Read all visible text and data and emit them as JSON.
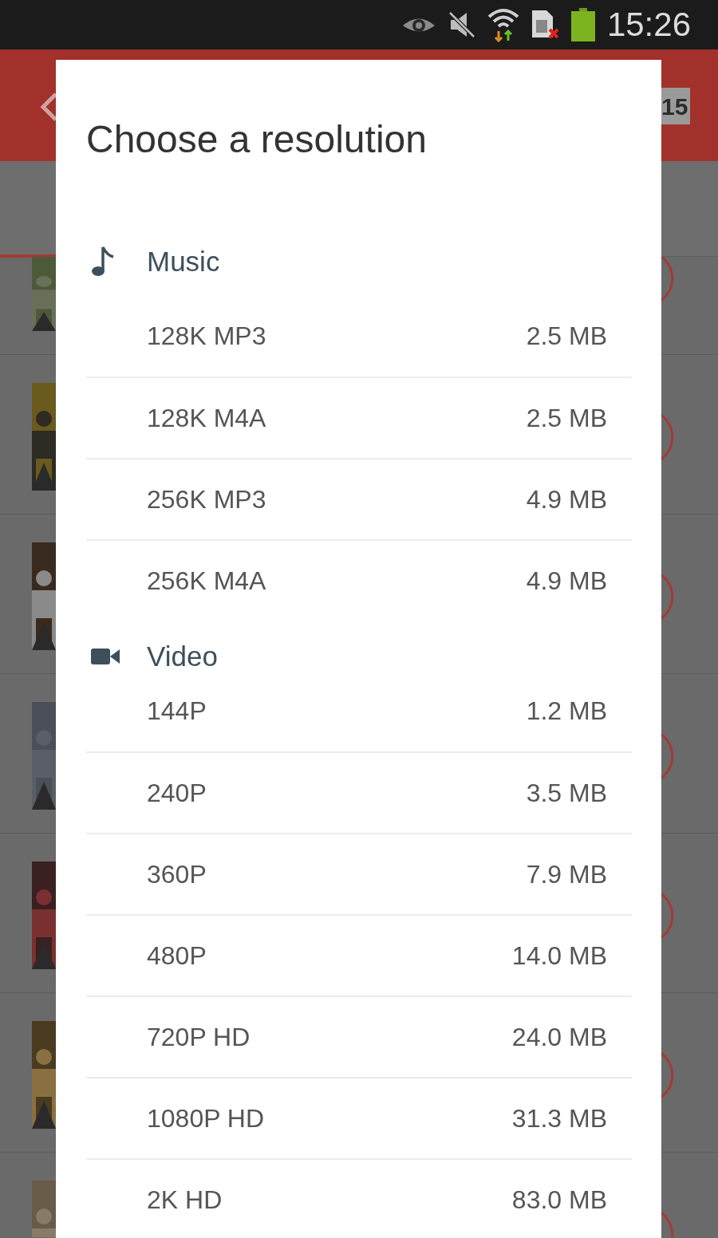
{
  "status_bar": {
    "time": "15:26"
  },
  "app_bar": {
    "badge": "15"
  },
  "dialog": {
    "title": "Choose a resolution",
    "sections": [
      {
        "kind": "music",
        "label": "Music",
        "options": [
          {
            "label": "128K MP3",
            "size": "2.5 MB"
          },
          {
            "label": "128K M4A",
            "size": "2.5 MB"
          },
          {
            "label": "256K MP3",
            "size": "4.9 MB"
          },
          {
            "label": "256K M4A",
            "size": "4.9 MB"
          }
        ]
      },
      {
        "kind": "video",
        "label": "Video",
        "options": [
          {
            "label": "144P",
            "size": "1.2 MB"
          },
          {
            "label": "240P",
            "size": "3.5 MB"
          },
          {
            "label": "360P",
            "size": "7.9 MB"
          },
          {
            "label": "480P",
            "size": "14.0 MB"
          },
          {
            "label": "720P HD",
            "size": "24.0 MB"
          },
          {
            "label": "1080P HD",
            "size": "31.3 MB"
          },
          {
            "label": "2K HD",
            "size": "83.0 MB"
          }
        ]
      }
    ]
  }
}
